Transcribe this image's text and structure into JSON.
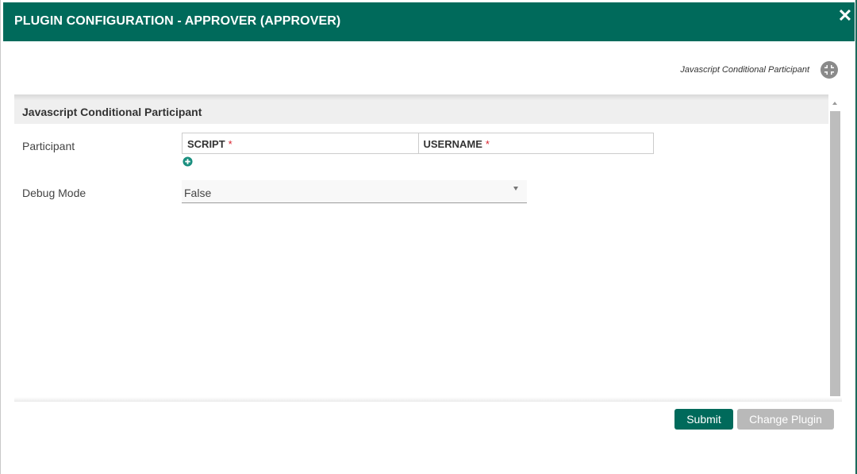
{
  "dialog": {
    "title": "PLUGIN CONFIGURATION - APPROVER (APPROVER)",
    "close_icon": "close-icon"
  },
  "plugin": {
    "name": "Javascript Conditional Participant",
    "icon": "collapse-arrows-icon"
  },
  "panel": {
    "title": "Javascript Conditional Participant"
  },
  "fields": {
    "participant": {
      "label": "Participant",
      "columns": [
        {
          "label": "SCRIPT",
          "required": "*"
        },
        {
          "label": "USERNAME",
          "required": "*"
        }
      ],
      "add_icon": "add-circle-icon"
    },
    "debug_mode": {
      "label": "Debug Mode",
      "value": "False"
    }
  },
  "buttons": {
    "submit": "Submit",
    "change_plugin": "Change Plugin"
  },
  "colors": {
    "header": "#006a5b",
    "primary_button": "#006a5b",
    "secondary_button": "#b9b9b9",
    "required": "#d9232e"
  }
}
